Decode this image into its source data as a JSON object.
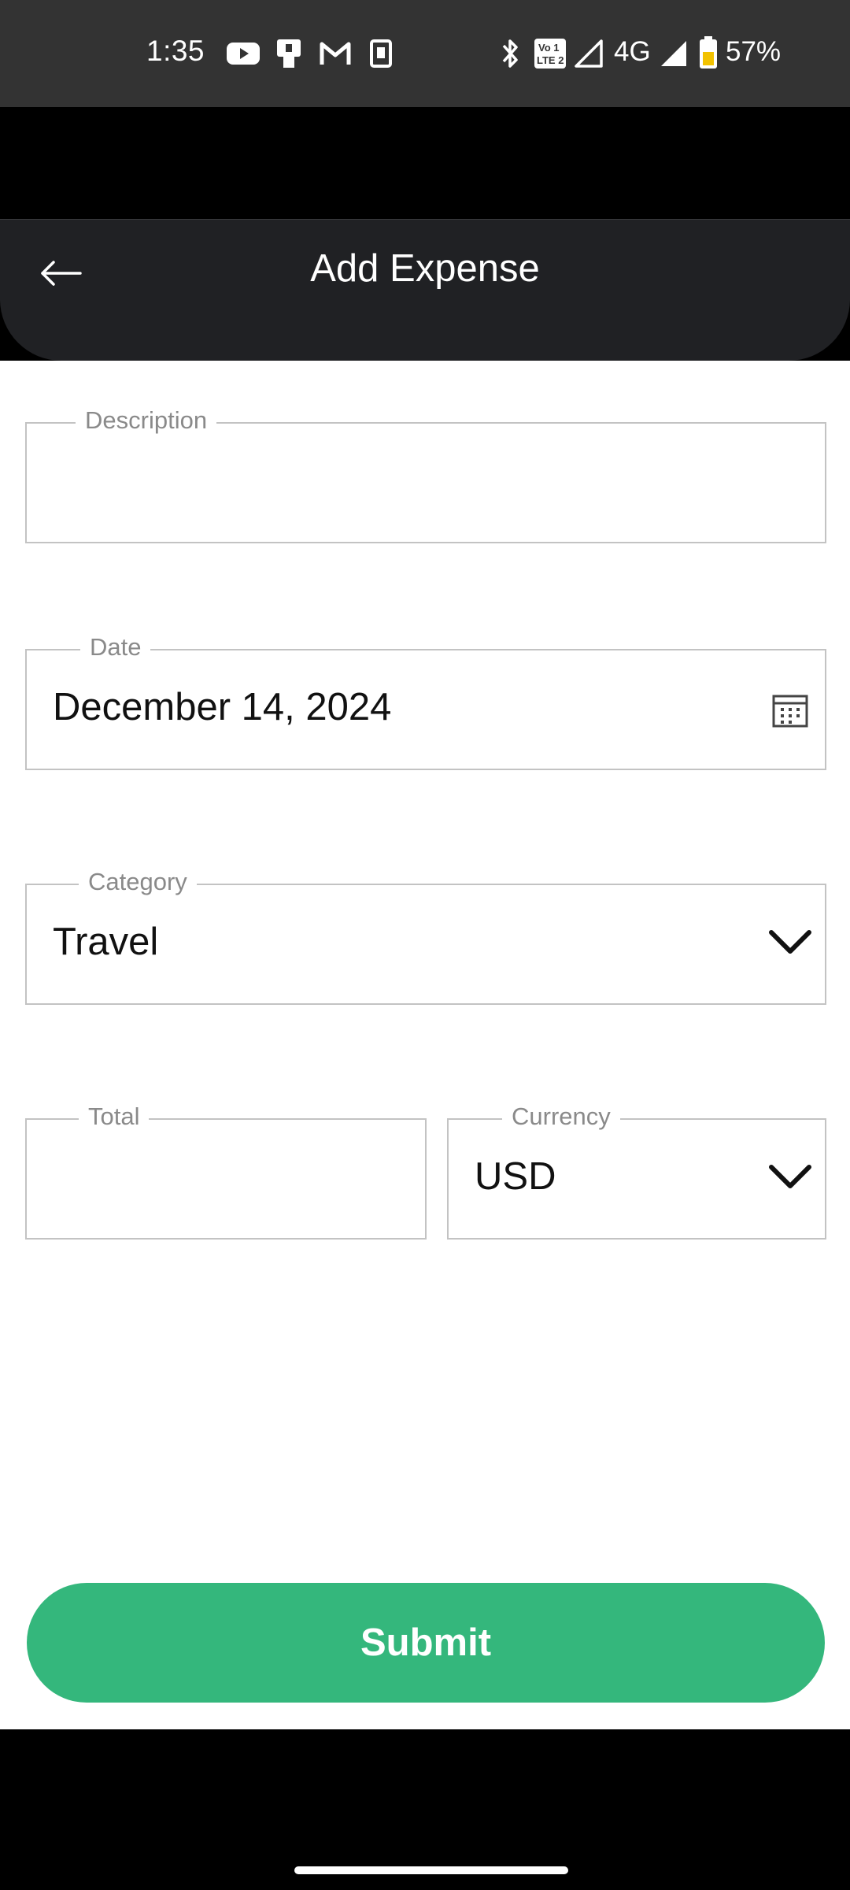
{
  "status_bar": {
    "time": "1:35",
    "network": "4G",
    "battery": "57%",
    "icons": [
      "youtube-icon",
      "clipboard-icon",
      "gmail-icon",
      "sim-card-icon",
      "bluetooth-icon",
      "volte-icon",
      "signal-icon",
      "signal-icon",
      "battery-icon"
    ]
  },
  "header": {
    "title": "Add Expense",
    "back_icon": "arrow-left-icon"
  },
  "form": {
    "description": {
      "label": "Description",
      "value": ""
    },
    "date": {
      "label": "Date",
      "value": "December 14, 2024",
      "icon": "calendar-icon"
    },
    "category": {
      "label": "Category",
      "value": "Travel",
      "icon": "chevron-down-icon"
    },
    "total": {
      "label": "Total",
      "value": ""
    },
    "currency": {
      "label": "Currency",
      "value": "USD",
      "icon": "chevron-down-icon"
    }
  },
  "submit_label": "Submit",
  "colors": {
    "accent": "#34b77c",
    "header_bg": "#202124",
    "status_bg": "#333333",
    "field_border": "#c3c3c3",
    "label": "#8a8a8a"
  }
}
